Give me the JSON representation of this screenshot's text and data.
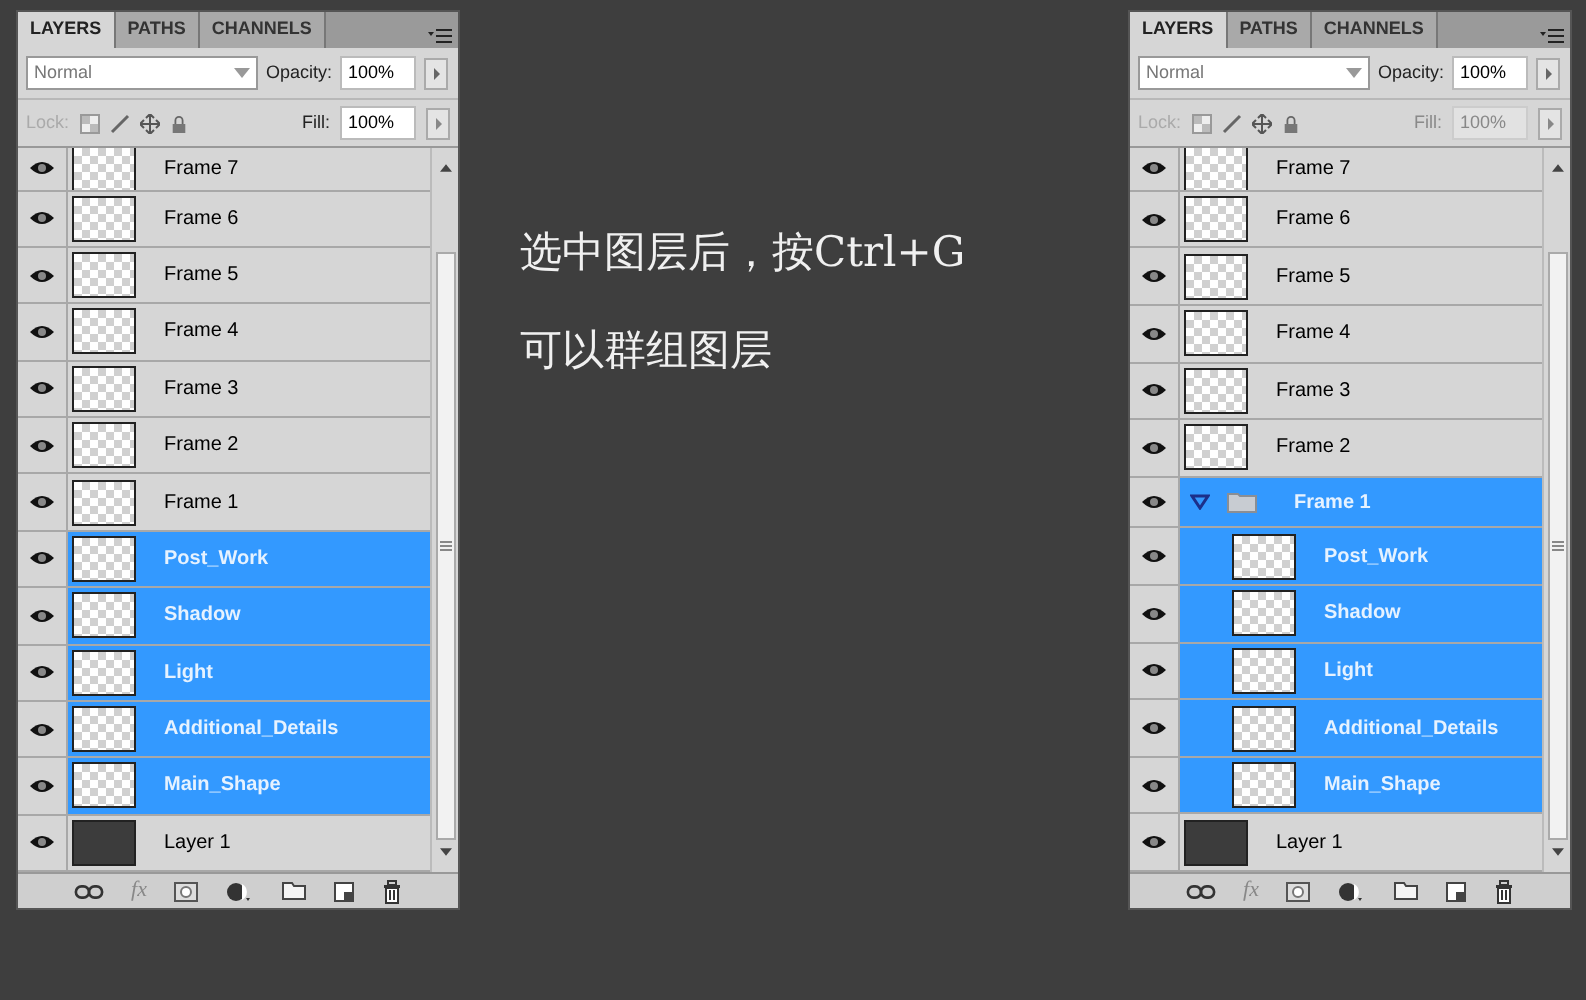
{
  "panels": [
    {
      "tabs": [
        {
          "label": "LAYERS",
          "selected": true
        },
        {
          "label": "PATHS",
          "selected": false
        },
        {
          "label": "CHANNELS",
          "selected": false
        }
      ],
      "blend_mode": "Normal",
      "opacity_label": "Opacity:",
      "opacity": "100%",
      "lock_label": "Lock:",
      "fill_label": "Fill:",
      "fill": "100%",
      "fill_disabled": false,
      "fx_label": "fx",
      "layers": [
        {
          "name": "Frame 7",
          "kind": "layer",
          "visible": true,
          "selected": false
        },
        {
          "name": "Frame 6",
          "kind": "layer",
          "visible": true,
          "selected": false
        },
        {
          "name": "Frame 5",
          "kind": "layer",
          "visible": true,
          "selected": false
        },
        {
          "name": "Frame 4",
          "kind": "layer",
          "visible": true,
          "selected": false
        },
        {
          "name": "Frame 3",
          "kind": "layer",
          "visible": true,
          "selected": false
        },
        {
          "name": "Frame 2",
          "kind": "layer",
          "visible": true,
          "selected": false
        },
        {
          "name": "Frame 1",
          "kind": "layer",
          "visible": true,
          "selected": false
        },
        {
          "name": "Post_Work",
          "kind": "layer",
          "visible": true,
          "selected": true
        },
        {
          "name": "Shadow",
          "kind": "layer",
          "visible": true,
          "selected": true
        },
        {
          "name": "Light",
          "kind": "layer",
          "visible": true,
          "selected": true
        },
        {
          "name": "Additional_Details",
          "kind": "layer",
          "visible": true,
          "selected": true
        },
        {
          "name": "Main_Shape",
          "kind": "layer",
          "visible": true,
          "selected": true
        },
        {
          "name": "Layer 1",
          "kind": "filled_layer",
          "visible": true,
          "selected": false
        }
      ]
    },
    {
      "tabs": [
        {
          "label": "LAYERS",
          "selected": true
        },
        {
          "label": "PATHS",
          "selected": false
        },
        {
          "label": "CHANNELS",
          "selected": false
        }
      ],
      "blend_mode": "Normal",
      "opacity_label": "Opacity:",
      "opacity": "100%",
      "lock_label": "Lock:",
      "fill_label": "Fill:",
      "fill": "100%",
      "fill_disabled": true,
      "fx_label": "fx",
      "layers": [
        {
          "name": "Frame 7",
          "kind": "layer",
          "visible": true,
          "selected": false
        },
        {
          "name": "Frame 6",
          "kind": "layer",
          "visible": true,
          "selected": false
        },
        {
          "name": "Frame 5",
          "kind": "layer",
          "visible": true,
          "selected": false
        },
        {
          "name": "Frame 4",
          "kind": "layer",
          "visible": true,
          "selected": false
        },
        {
          "name": "Frame 3",
          "kind": "layer",
          "visible": true,
          "selected": false
        },
        {
          "name": "Frame 2",
          "kind": "layer",
          "visible": true,
          "selected": false
        },
        {
          "name": "Frame 1",
          "kind": "group",
          "visible": true,
          "selected": true,
          "expanded": true,
          "children": [
            {
              "name": "Post_Work",
              "kind": "layer",
              "visible": true,
              "selected": true
            },
            {
              "name": "Shadow",
              "kind": "layer",
              "visible": true,
              "selected": true
            },
            {
              "name": "Light",
              "kind": "layer",
              "visible": true,
              "selected": true
            },
            {
              "name": "Additional_Details",
              "kind": "layer",
              "visible": true,
              "selected": true
            },
            {
              "name": "Main_Shape",
              "kind": "layer",
              "visible": true,
              "selected": true
            }
          ]
        },
        {
          "name": "Layer 1",
          "kind": "filled_layer",
          "visible": true,
          "selected": false
        }
      ]
    }
  ],
  "caption": [
    "选中图层后，按Ctrl+G",
    "可以群组图层"
  ]
}
